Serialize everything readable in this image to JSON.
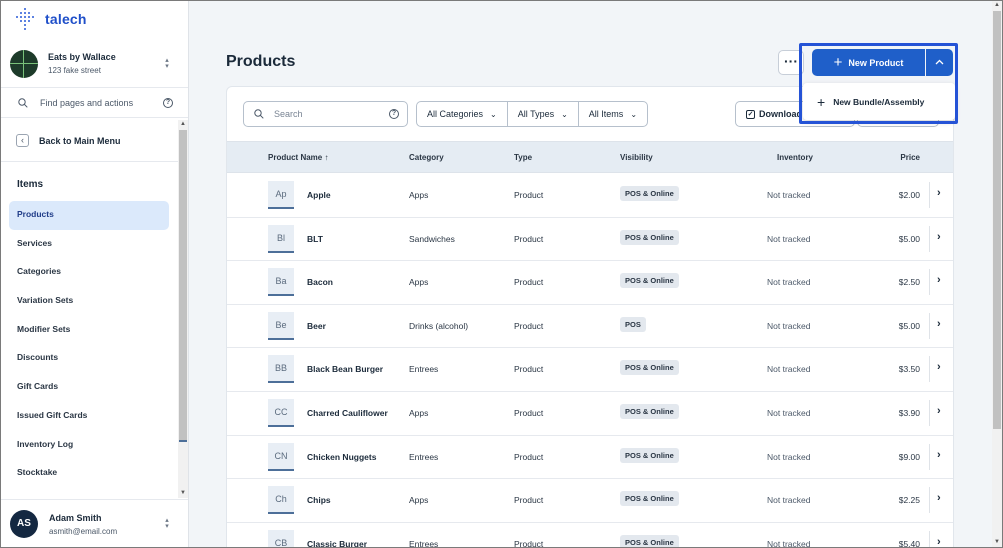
{
  "brand": {
    "name": "talech"
  },
  "org": {
    "name": "Eats by Wallace",
    "address": "123 fake street"
  },
  "nav_search": {
    "placeholder": "Find pages and actions"
  },
  "back": {
    "label": "Back to Main Menu"
  },
  "nav": {
    "heading": "Items",
    "items": [
      {
        "label": "Products",
        "active": true
      },
      {
        "label": "Services"
      },
      {
        "label": "Categories"
      },
      {
        "label": "Variation Sets"
      },
      {
        "label": "Modifier Sets"
      },
      {
        "label": "Discounts"
      },
      {
        "label": "Gift Cards"
      },
      {
        "label": "Issued Gift Cards"
      },
      {
        "label": "Inventory Log"
      },
      {
        "label": "Stocktake"
      }
    ]
  },
  "user": {
    "initials": "AS",
    "name": "Adam Smith",
    "email": "asmith@email.com"
  },
  "page": {
    "title": "Products",
    "more_label": "···",
    "new_product_label": "New Product",
    "dropdown_item_label": "New Bundle/Assembly"
  },
  "toolbar": {
    "search_placeholder": "Search",
    "filters": [
      "All Categories",
      "All Types",
      "All Items"
    ],
    "download_label": "Download"
  },
  "table": {
    "headers": {
      "name": "Product Name ↑",
      "category": "Category",
      "type": "Type",
      "visibility": "Visibility",
      "inventory": "Inventory",
      "price": "Price"
    },
    "rows": [
      {
        "abbr": "Ap",
        "name": "Apple",
        "category": "Apps",
        "type": "Product",
        "visibility": "POS & Online",
        "inventory": "Not tracked",
        "price": "$2.00"
      },
      {
        "abbr": "Bl",
        "name": "BLT",
        "category": "Sandwiches",
        "type": "Product",
        "visibility": "POS & Online",
        "inventory": "Not tracked",
        "price": "$5.00"
      },
      {
        "abbr": "Ba",
        "name": "Bacon",
        "category": "Apps",
        "type": "Product",
        "visibility": "POS & Online",
        "inventory": "Not tracked",
        "price": "$2.50"
      },
      {
        "abbr": "Be",
        "name": "Beer",
        "category": "Drinks (alcohol)",
        "type": "Product",
        "visibility": "POS",
        "inventory": "Not tracked",
        "price": "$5.00"
      },
      {
        "abbr": "BB",
        "name": "Black Bean Burger",
        "category": "Entrees",
        "type": "Product",
        "visibility": "POS & Online",
        "inventory": "Not tracked",
        "price": "$3.50"
      },
      {
        "abbr": "CC",
        "name": "Charred Cauliflower",
        "category": "Apps",
        "type": "Product",
        "visibility": "POS & Online",
        "inventory": "Not tracked",
        "price": "$3.90"
      },
      {
        "abbr": "CN",
        "name": "Chicken Nuggets",
        "category": "Entrees",
        "type": "Product",
        "visibility": "POS & Online",
        "inventory": "Not tracked",
        "price": "$9.00"
      },
      {
        "abbr": "Ch",
        "name": "Chips",
        "category": "Apps",
        "type": "Product",
        "visibility": "POS & Online",
        "inventory": "Not tracked",
        "price": "$2.25"
      },
      {
        "abbr": "CB",
        "name": "Classic Burger",
        "category": "Entrees",
        "type": "Product",
        "visibility": "POS & Online",
        "inventory": "Not tracked",
        "price": "$5.40"
      }
    ]
  },
  "colors": {
    "accent": "#1f5fc9",
    "highlight": "#2553d6",
    "active_nav_bg": "#dbe9fb"
  }
}
